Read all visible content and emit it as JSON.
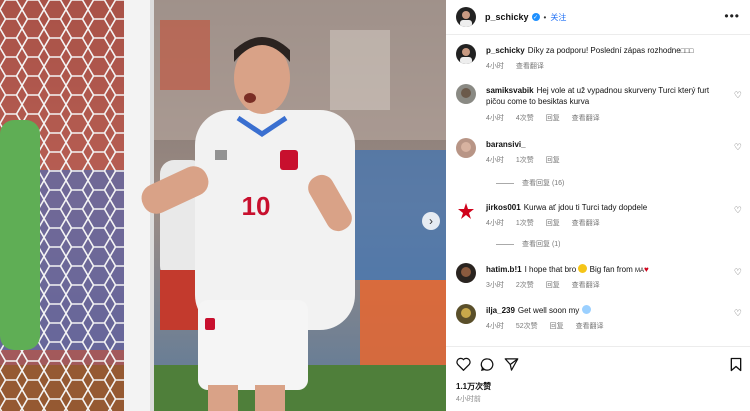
{
  "post": {
    "username": "p_schicky",
    "follow_label": "关注",
    "more_icon": "more-icon",
    "shirt_number": "10",
    "likes": "1.1万次赞",
    "time": "4小时前"
  },
  "comments": [
    {
      "username": "p_schicky",
      "text": "Díky za podporu! Poslední zápas rozhodne",
      "meta": {
        "time": "4小时",
        "translate": "查看翻译"
      },
      "has_like": false
    },
    {
      "username": "samiksvabik",
      "text": "Hej vole at už vypadnou skurveny Turci který furt pičou come to besiktas kurva",
      "meta": {
        "time": "4小时",
        "likes": "4次赞",
        "reply": "回复",
        "translate": "查看翻译"
      },
      "has_like": true
    },
    {
      "username": "baransivi_",
      "text": "",
      "meta": {
        "time": "4小时",
        "likes": "1次赞",
        "reply": "回复"
      },
      "replies": "查看回复 (16)",
      "has_like": true
    },
    {
      "username": "jirkos001",
      "text": "Kurwa ať jdou ti Turci tady dopdele",
      "meta": {
        "time": "4小时",
        "likes": "1次赞",
        "reply": "回复",
        "translate": "查看翻译"
      },
      "replies": "查看回复 (1)",
      "has_like": true
    },
    {
      "username": "hatim.b!1",
      "text": "I hope that bro",
      "text2": "Big fan from",
      "text3": "MA",
      "meta": {
        "time": "3小时",
        "likes": "2次赞",
        "reply": "回复",
        "translate": "查看翻译"
      },
      "has_like": true
    },
    {
      "username": "ilja_239",
      "text": "Get well soon my",
      "meta": {
        "time": "4小时",
        "likes": "52次赞",
        "reply": "回复",
        "translate": "查看翻译"
      },
      "has_like": true
    }
  ]
}
